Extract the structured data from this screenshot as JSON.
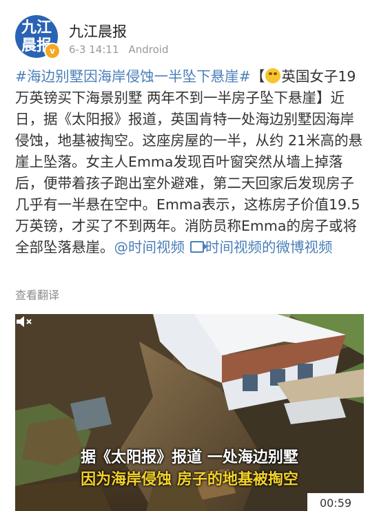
{
  "account": {
    "avatar_line1": "九江",
    "avatar_line2": "晨报",
    "verified_badge": "v",
    "name": "九江晨报",
    "time": "6-3 14:11",
    "source": "Android"
  },
  "post": {
    "hashtag": "#海边别墅因海岸侵蚀一半坠下悬崖#",
    "bracket_open": "【",
    "emoji_icon": "grinning-face-emoji",
    "body_head": "英国女子19万英镑买下海景别墅 两年不到一半房子坠下悬崖】近日，据《太阳报》报道，英国肯特一处海边别墅因海岸侵蚀，地基被掏空。这座房屋的一半，从约 21米高的悬崖上坠落。女主人Emma发现百叶窗突然从墙上掉落后，便带着孩子跑出室外避难，第二天回家后发现房子几乎有一半悬在空中。Emma表示，这栋房子价值19.5万英镑，才买了不到两年。消防员称Emma的房子或将全部坠落悬崖。",
    "mention": "@时间视频",
    "video_link": "时间视频的微博视频",
    "translate_label": "查看翻译"
  },
  "video": {
    "subtitle_line1": "据《太阳报》报道 一处海边别墅",
    "subtitle_line2": "因为海岸侵蚀 房子的地基被掏空",
    "duration": "00:59",
    "mute_icon": "speaker-muted-icon"
  }
}
